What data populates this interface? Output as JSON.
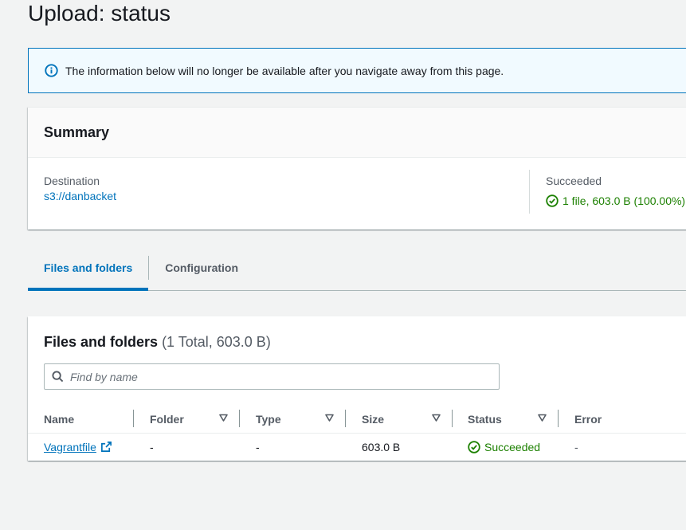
{
  "page": {
    "title": "Upload: status"
  },
  "alert": {
    "icon": "info-icon",
    "text": "The information below will no longer be available after you navigate away from this page."
  },
  "summary": {
    "title": "Summary",
    "destination_label": "Destination",
    "destination_value": "s3://danbacket",
    "succeeded_label": "Succeeded",
    "succeeded_value": "1 file, 603.0 B (100.00%)",
    "succeeded_icon": "check-circle-icon"
  },
  "tabs": [
    {
      "label": "Files and folders",
      "active": true
    },
    {
      "label": "Configuration",
      "active": false
    }
  ],
  "files": {
    "title": "Files and folders",
    "count": "(1 Total, 603.0 B)",
    "search_placeholder": "Find by name",
    "columns": [
      "Name",
      "Folder",
      "Type",
      "Size",
      "Status",
      "Error"
    ],
    "rows": [
      {
        "name": "Vagrantfile",
        "folder": "-",
        "type": "-",
        "size": "603.0 B",
        "status": "Succeeded",
        "error": "-"
      }
    ]
  },
  "colors": {
    "link": "#0073bb",
    "success": "#1d8102",
    "info_bg": "#f1faff",
    "page_bg": "#f2f3f3"
  }
}
